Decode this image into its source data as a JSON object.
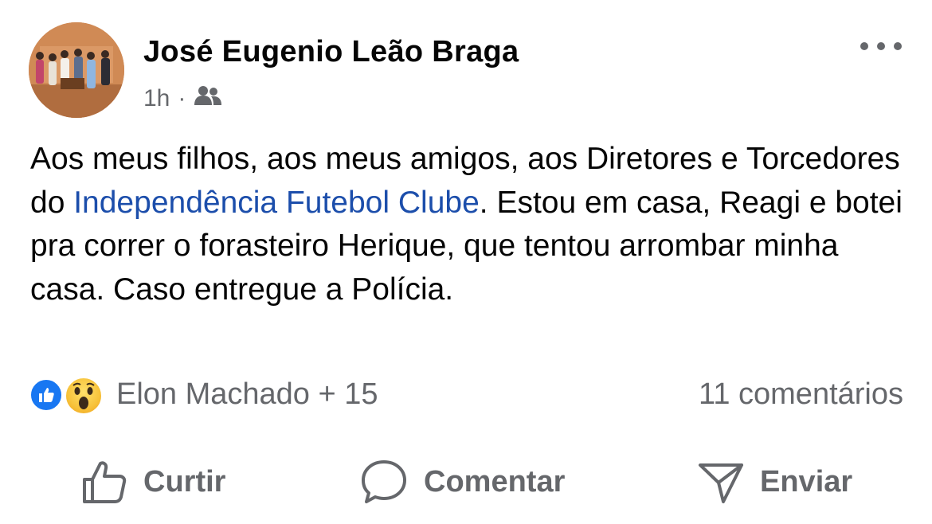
{
  "post": {
    "author": "José Eugenio Leão Braga",
    "time": "1h",
    "separator": "·",
    "audience_icon": "friends-icon",
    "text_before_link": "Aos meus filhos, aos meus amigos, aos Diretores e Torcedores do ",
    "link_text": "Independência Futebol Clube",
    "text_after_link": ". Estou em casa, Reagi e botei pra correr o forasteiro Herique, que tentou arrombar minha casa. Caso entregue a Polícia."
  },
  "reactions": {
    "icons": [
      "like-reaction-icon",
      "wow-reaction-icon"
    ],
    "names": "Elon Machado + 15",
    "comments": "11 comentários"
  },
  "actions": {
    "like_label": "Curtir",
    "comment_label": "Comentar",
    "send_label": "Enviar"
  },
  "colors": {
    "link": "#1c4eab",
    "secondary_text": "#65676b",
    "like_blue": "#1877f2"
  }
}
